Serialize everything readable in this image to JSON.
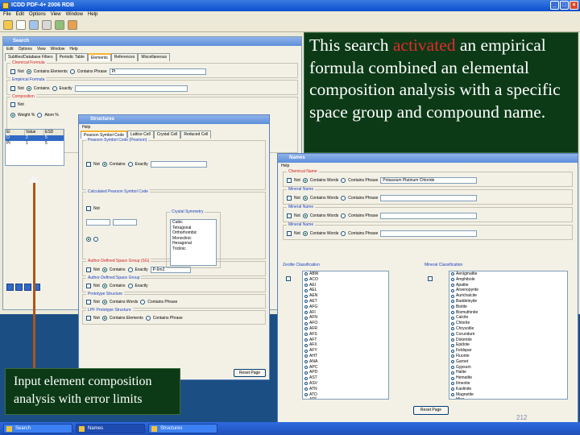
{
  "app": {
    "title": "ICDD PDF-4+ 2006 RDB",
    "menu": [
      "File",
      "Edit",
      "Options",
      "View",
      "Window",
      "Help"
    ],
    "toolbar_icons": [
      "folder-icon",
      "document-icon",
      "search-icon",
      "print-icon",
      "settings-icon",
      "view-icon"
    ]
  },
  "search": {
    "title": "Search",
    "menu": [
      "Edit",
      "Options",
      "View",
      "Window",
      "Help"
    ],
    "tabs": [
      "Subfiles/Database Filters",
      "Periodic Table",
      "Elements",
      "References",
      "Miscellaneous"
    ],
    "active_tab": "Elements",
    "fieldsets": [
      {
        "label": "Chemical Formula",
        "options": [
          "Not",
          "Contains Elements",
          "Contains Phrase"
        ],
        "value": "Pt"
      },
      {
        "label": "Empirical Formula",
        "options": [
          "Not",
          "Contains",
          "Exactly"
        ],
        "value": ""
      },
      {
        "label": "Composition",
        "options": [
          "Not"
        ],
        "value": ""
      }
    ],
    "weight_label": "Weight %",
    "atom_label": "Atom %",
    "table_headers": [
      "El",
      "Value",
      "ESD"
    ],
    "table_rows": [
      [
        "O",
        "2",
        "5"
      ],
      [
        "Pt",
        "1",
        "5"
      ]
    ]
  },
  "structures": {
    "title": "Structures",
    "menu": "Help",
    "tabs": [
      "Pearson Symbol Code",
      "Lattice Cell",
      "Crystal Cell",
      "Reduced Cell"
    ],
    "fieldsets": [
      "Pearson Symbol Code (Pearson)",
      "Calculated Pearson Symbol Code",
      "Author-Defined Space Group (SG)",
      "Author-Defined Space Group",
      "Prototype Structure",
      "LPF Prototype Structure"
    ],
    "crystal_symmetry_label": "Crystal Symmetry",
    "crystal_options": [
      "Cubic",
      "Tetragonal",
      "Orthorhombic",
      "Monoclinic",
      "Hexagonal",
      "Triclinic"
    ],
    "space_group_value": "P-6m2",
    "options": [
      "Not",
      "Contains",
      "Exactly",
      "Contains Words",
      "Contains Phrase",
      "Contains Elements"
    ],
    "reset_label": "Reset Page"
  },
  "names": {
    "title": "Names",
    "menu": "Help",
    "fieldsets": [
      {
        "label": "Chemical Name",
        "value": "Potassium Platinum Chloride"
      },
      {
        "label": "Mineral Name",
        "value": ""
      },
      {
        "label": "Mineral Name",
        "value": ""
      },
      {
        "label": "Mineral Name",
        "value": ""
      }
    ],
    "options": [
      "Not",
      "Contains Words",
      "Contains Phrase"
    ],
    "zeolite_label": "Zeolite Classification",
    "mineral_class_label": "Mineral Classification",
    "zeolite_items": [
      "ABW",
      "ACO",
      "AEI",
      "AEL",
      "AEN",
      "AET",
      "AFG",
      "AFI",
      "AFN",
      "AFO",
      "AFR",
      "AFS",
      "AFT",
      "AFX",
      "AFY",
      "AHT",
      "ANA",
      "APC",
      "APD",
      "AST",
      "ASV",
      "ATN",
      "ATO",
      "ATS",
      "ATT",
      "ATV",
      "AWO",
      "AWW"
    ],
    "mineral_items": [
      "Aenigmatite",
      "Amphibole",
      "Apatite",
      "Arsenopyrite",
      "Aurichalcite",
      "Baddeleyite",
      "Biotite",
      "Bismuthinite",
      "Calcite",
      "Chlorite",
      "Chrysotile",
      "Corundum",
      "Dolomite",
      "Epidote",
      "Feldspar",
      "Fluorite",
      "Garnet",
      "Gypsum",
      "Halite",
      "Hematite",
      "Ilmenite",
      "Kaolinite",
      "Magnetite",
      "Mica",
      "Olivine",
      "Pyroxene",
      "Quartz",
      "Spinel"
    ],
    "reset_label": "Reset Page",
    "page_number": "212"
  },
  "callouts": {
    "top_before": "This search ",
    "top_highlight": "activated",
    "top_after": " an empirical formula combined an elemental composition analysis with a specific space group and compound name.",
    "bottom": "Input element composition analysis with error limits"
  },
  "taskbar": [
    "Search",
    "Names",
    "Structures"
  ],
  "colors": {
    "callout_bg": "#0c3a17",
    "highlight": "#e32b2b",
    "arrow": "#b05418",
    "desktop": "#1b4f84"
  }
}
